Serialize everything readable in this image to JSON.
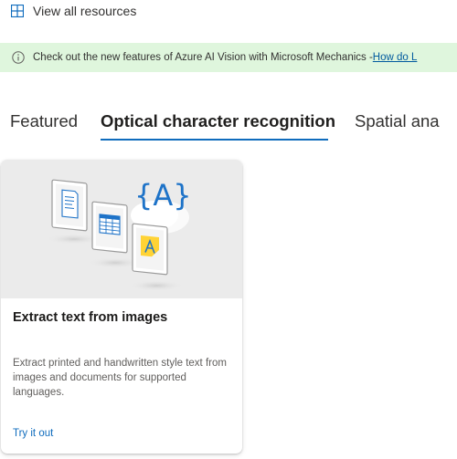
{
  "view_all": {
    "label": "View all resources",
    "icon": "grid-icon"
  },
  "banner": {
    "icon": "info-icon",
    "text": "Check out the new features of Azure AI Vision with Microsoft Mechanics - ",
    "link": "How do L"
  },
  "tabs": [
    {
      "label": "Featured",
      "selected": false
    },
    {
      "label": "Optical character recognition",
      "selected": true
    },
    {
      "label": "Spatial ana",
      "selected": false
    }
  ],
  "accent_color": "#0f6cbd",
  "card": {
    "image": "ocr-illustration",
    "image_text": "{A}",
    "title": "Extract text from images",
    "description": "Extract printed and handwritten style text from images and documents for supported languages.",
    "link": "Try it out"
  }
}
